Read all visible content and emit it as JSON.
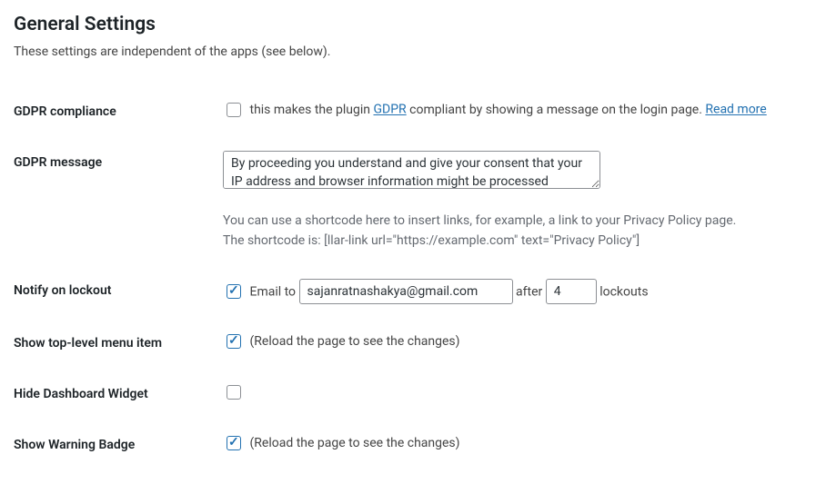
{
  "header": {
    "title": "General Settings",
    "description": "These settings are independent of the apps (see below)."
  },
  "gdpr_compliance": {
    "label": "GDPR compliance",
    "checked": false,
    "text_before": "this makes the plugin ",
    "link_gdpr": "GDPR",
    "text_after": " compliant by showing a message on the login page. ",
    "link_readmore": "Read more"
  },
  "gdpr_message": {
    "label": "GDPR message",
    "value": "By proceeding you understand and give your consent that your IP address and browser information might be processed",
    "hint_line1": "You can use a shortcode here to insert links, for example, a link to your Privacy Policy page.",
    "hint_line2": "The shortcode is: [llar-link url=\"https://example.com\" text=\"Privacy Policy\"]"
  },
  "notify_lockout": {
    "label": "Notify on lockout",
    "checked": true,
    "email_to_text": "Email to",
    "email_value": "sajanratnashakya@gmail.com",
    "after_text": "after",
    "lockouts_value": "4",
    "lockouts_text": "lockouts"
  },
  "show_menu": {
    "label": "Show top-level menu item",
    "checked": true,
    "note": "(Reload the page to see the changes)"
  },
  "hide_dashboard": {
    "label": "Hide Dashboard Widget",
    "checked": false
  },
  "show_warning": {
    "label": "Show Warning Badge",
    "checked": true,
    "note": "(Reload the page to see the changes)"
  }
}
